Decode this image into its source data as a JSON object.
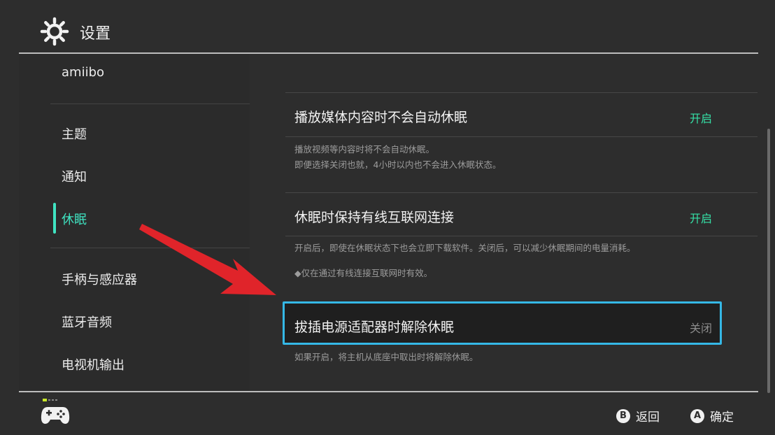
{
  "header": {
    "title": "设置",
    "icon": "gear-icon"
  },
  "sidebar": {
    "items": [
      {
        "label": "amiibo"
      },
      {
        "label": "主题"
      },
      {
        "label": "通知"
      },
      {
        "label": "休眠",
        "active": true
      },
      {
        "label": "手柄与感应器"
      },
      {
        "label": "蓝牙音频"
      },
      {
        "label": "电视机输出"
      }
    ]
  },
  "settings": [
    {
      "title": "播放媒体内容时不会自动休眠",
      "value": "开启",
      "desc": [
        "播放视频等内容时将不会自动休眠。",
        "即便选择关闭也就，4小时以内也不会进入休眠状态。"
      ]
    },
    {
      "title": "休眠时保持有线互联网连接",
      "value": "开启",
      "desc": [
        "开启后，即使在休眠状态下也会立即下载软件。关闭后，可以减少休眠期间的电量消耗。",
        "◆仅在通过有线连接互联网时有效。"
      ]
    },
    {
      "title": "拔插电源适配器时解除休眠",
      "value": "关闭",
      "desc": [
        "如果开启，将主机从底座中取出时将解除休眠。"
      ]
    }
  ],
  "footer": {
    "back": {
      "key": "B",
      "label": "返回"
    },
    "confirm": {
      "key": "A",
      "label": "确定"
    }
  },
  "colors": {
    "accent": "#3fe3c1",
    "on": "#35e0a6",
    "focus": "#35b8e6",
    "arrow": "#e0242a"
  }
}
